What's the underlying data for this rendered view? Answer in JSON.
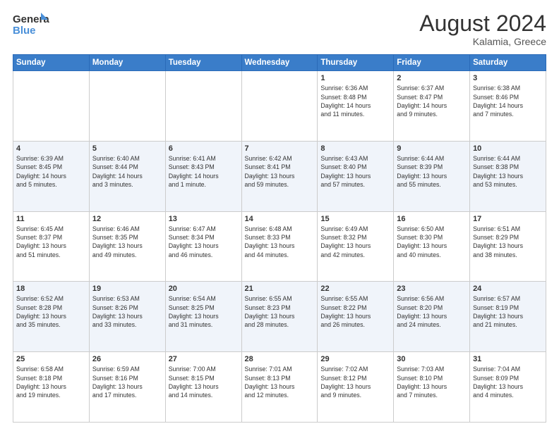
{
  "header": {
    "logo_line1": "General",
    "logo_line2": "Blue",
    "main_title": "August 2024",
    "subtitle": "Kalamia, Greece"
  },
  "days_of_week": [
    "Sunday",
    "Monday",
    "Tuesday",
    "Wednesday",
    "Thursday",
    "Friday",
    "Saturday"
  ],
  "weeks": [
    [
      {
        "day": "",
        "info": ""
      },
      {
        "day": "",
        "info": ""
      },
      {
        "day": "",
        "info": ""
      },
      {
        "day": "",
        "info": ""
      },
      {
        "day": "1",
        "info": "Sunrise: 6:36 AM\nSunset: 8:48 PM\nDaylight: 14 hours\nand 11 minutes."
      },
      {
        "day": "2",
        "info": "Sunrise: 6:37 AM\nSunset: 8:47 PM\nDaylight: 14 hours\nand 9 minutes."
      },
      {
        "day": "3",
        "info": "Sunrise: 6:38 AM\nSunset: 8:46 PM\nDaylight: 14 hours\nand 7 minutes."
      }
    ],
    [
      {
        "day": "4",
        "info": "Sunrise: 6:39 AM\nSunset: 8:45 PM\nDaylight: 14 hours\nand 5 minutes."
      },
      {
        "day": "5",
        "info": "Sunrise: 6:40 AM\nSunset: 8:44 PM\nDaylight: 14 hours\nand 3 minutes."
      },
      {
        "day": "6",
        "info": "Sunrise: 6:41 AM\nSunset: 8:43 PM\nDaylight: 14 hours\nand 1 minute."
      },
      {
        "day": "7",
        "info": "Sunrise: 6:42 AM\nSunset: 8:41 PM\nDaylight: 13 hours\nand 59 minutes."
      },
      {
        "day": "8",
        "info": "Sunrise: 6:43 AM\nSunset: 8:40 PM\nDaylight: 13 hours\nand 57 minutes."
      },
      {
        "day": "9",
        "info": "Sunrise: 6:44 AM\nSunset: 8:39 PM\nDaylight: 13 hours\nand 55 minutes."
      },
      {
        "day": "10",
        "info": "Sunrise: 6:44 AM\nSunset: 8:38 PM\nDaylight: 13 hours\nand 53 minutes."
      }
    ],
    [
      {
        "day": "11",
        "info": "Sunrise: 6:45 AM\nSunset: 8:37 PM\nDaylight: 13 hours\nand 51 minutes."
      },
      {
        "day": "12",
        "info": "Sunrise: 6:46 AM\nSunset: 8:35 PM\nDaylight: 13 hours\nand 49 minutes."
      },
      {
        "day": "13",
        "info": "Sunrise: 6:47 AM\nSunset: 8:34 PM\nDaylight: 13 hours\nand 46 minutes."
      },
      {
        "day": "14",
        "info": "Sunrise: 6:48 AM\nSunset: 8:33 PM\nDaylight: 13 hours\nand 44 minutes."
      },
      {
        "day": "15",
        "info": "Sunrise: 6:49 AM\nSunset: 8:32 PM\nDaylight: 13 hours\nand 42 minutes."
      },
      {
        "day": "16",
        "info": "Sunrise: 6:50 AM\nSunset: 8:30 PM\nDaylight: 13 hours\nand 40 minutes."
      },
      {
        "day": "17",
        "info": "Sunrise: 6:51 AM\nSunset: 8:29 PM\nDaylight: 13 hours\nand 38 minutes."
      }
    ],
    [
      {
        "day": "18",
        "info": "Sunrise: 6:52 AM\nSunset: 8:28 PM\nDaylight: 13 hours\nand 35 minutes."
      },
      {
        "day": "19",
        "info": "Sunrise: 6:53 AM\nSunset: 8:26 PM\nDaylight: 13 hours\nand 33 minutes."
      },
      {
        "day": "20",
        "info": "Sunrise: 6:54 AM\nSunset: 8:25 PM\nDaylight: 13 hours\nand 31 minutes."
      },
      {
        "day": "21",
        "info": "Sunrise: 6:55 AM\nSunset: 8:23 PM\nDaylight: 13 hours\nand 28 minutes."
      },
      {
        "day": "22",
        "info": "Sunrise: 6:55 AM\nSunset: 8:22 PM\nDaylight: 13 hours\nand 26 minutes."
      },
      {
        "day": "23",
        "info": "Sunrise: 6:56 AM\nSunset: 8:20 PM\nDaylight: 13 hours\nand 24 minutes."
      },
      {
        "day": "24",
        "info": "Sunrise: 6:57 AM\nSunset: 8:19 PM\nDaylight: 13 hours\nand 21 minutes."
      }
    ],
    [
      {
        "day": "25",
        "info": "Sunrise: 6:58 AM\nSunset: 8:18 PM\nDaylight: 13 hours\nand 19 minutes."
      },
      {
        "day": "26",
        "info": "Sunrise: 6:59 AM\nSunset: 8:16 PM\nDaylight: 13 hours\nand 17 minutes."
      },
      {
        "day": "27",
        "info": "Sunrise: 7:00 AM\nSunset: 8:15 PM\nDaylight: 13 hours\nand 14 minutes."
      },
      {
        "day": "28",
        "info": "Sunrise: 7:01 AM\nSunset: 8:13 PM\nDaylight: 13 hours\nand 12 minutes."
      },
      {
        "day": "29",
        "info": "Sunrise: 7:02 AM\nSunset: 8:12 PM\nDaylight: 13 hours\nand 9 minutes."
      },
      {
        "day": "30",
        "info": "Sunrise: 7:03 AM\nSunset: 8:10 PM\nDaylight: 13 hours\nand 7 minutes."
      },
      {
        "day": "31",
        "info": "Sunrise: 7:04 AM\nSunset: 8:09 PM\nDaylight: 13 hours\nand 4 minutes."
      }
    ]
  ]
}
